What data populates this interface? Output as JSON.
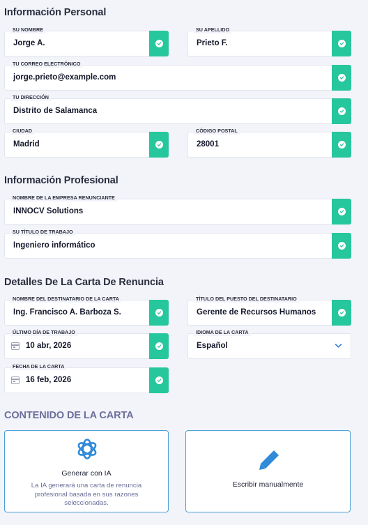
{
  "sections": {
    "personal": "Información Personal",
    "professional": "Información Profesional",
    "letter_details": "Detalles De La Carta De Renuncia",
    "content": "CONTENIDO DE LA CARTA"
  },
  "fields": {
    "first_name": {
      "label": "SU NOMBRE",
      "value": "Jorge A."
    },
    "last_name": {
      "label": "SU APELLIDO",
      "value": "Prieto F."
    },
    "email": {
      "label": "TU CORREO ELECTRÓNICO",
      "value": "jorge.prieto@example.com"
    },
    "address": {
      "label": "TU DIRECCIÓN",
      "value": "Distrito de Salamanca"
    },
    "city": {
      "label": "CIUDAD",
      "value": "Madrid"
    },
    "postal_code": {
      "label": "CÓDIGO POSTAL",
      "value": "28001"
    },
    "company": {
      "label": "NOMBRE DE LA EMPRESA RENUNCIANTE",
      "value": "INNOCV Solutions"
    },
    "job_title": {
      "label": "SU TÍTULO DE TRABAJO",
      "value": "Ingeniero informático"
    },
    "recipient_name": {
      "label": "NOMBRE DEL DESTINATARIO DE LA CARTA",
      "value": "Ing. Francisco A. Barboza S."
    },
    "recipient_title": {
      "label": "TÍTULO DEL PUESTO DEL DESTINATARIO",
      "value": "Gerente de Recursos Humanos"
    },
    "last_day": {
      "label": "ÚLTIMO DÍA DE TRABAJO",
      "value": "10 abr, 2026"
    },
    "letter_language": {
      "label": "IDIOMA DE LA CARTA",
      "value": "Español"
    },
    "letter_date": {
      "label": "FECHA DE LA CARTA",
      "value": "16 feb, 2026"
    }
  },
  "cards": {
    "ai": {
      "title": "Generar con IA",
      "description": "La IA generará una carta de renuncia profesional basada en sus razones seleccionadas."
    },
    "manual": {
      "title": "Escribir manualmente"
    }
  },
  "colors": {
    "check_green": "#27c79d",
    "card_border": "#4aa0d8",
    "accent_blue": "#2f8ad8",
    "chevron": "#2f7fd0"
  },
  "icons": {
    "check": "check-circle-icon",
    "calendar": "calendar-icon",
    "chevron": "chevron-down-icon",
    "ai": "openai-logo-icon",
    "manual": "pencil-icon"
  }
}
